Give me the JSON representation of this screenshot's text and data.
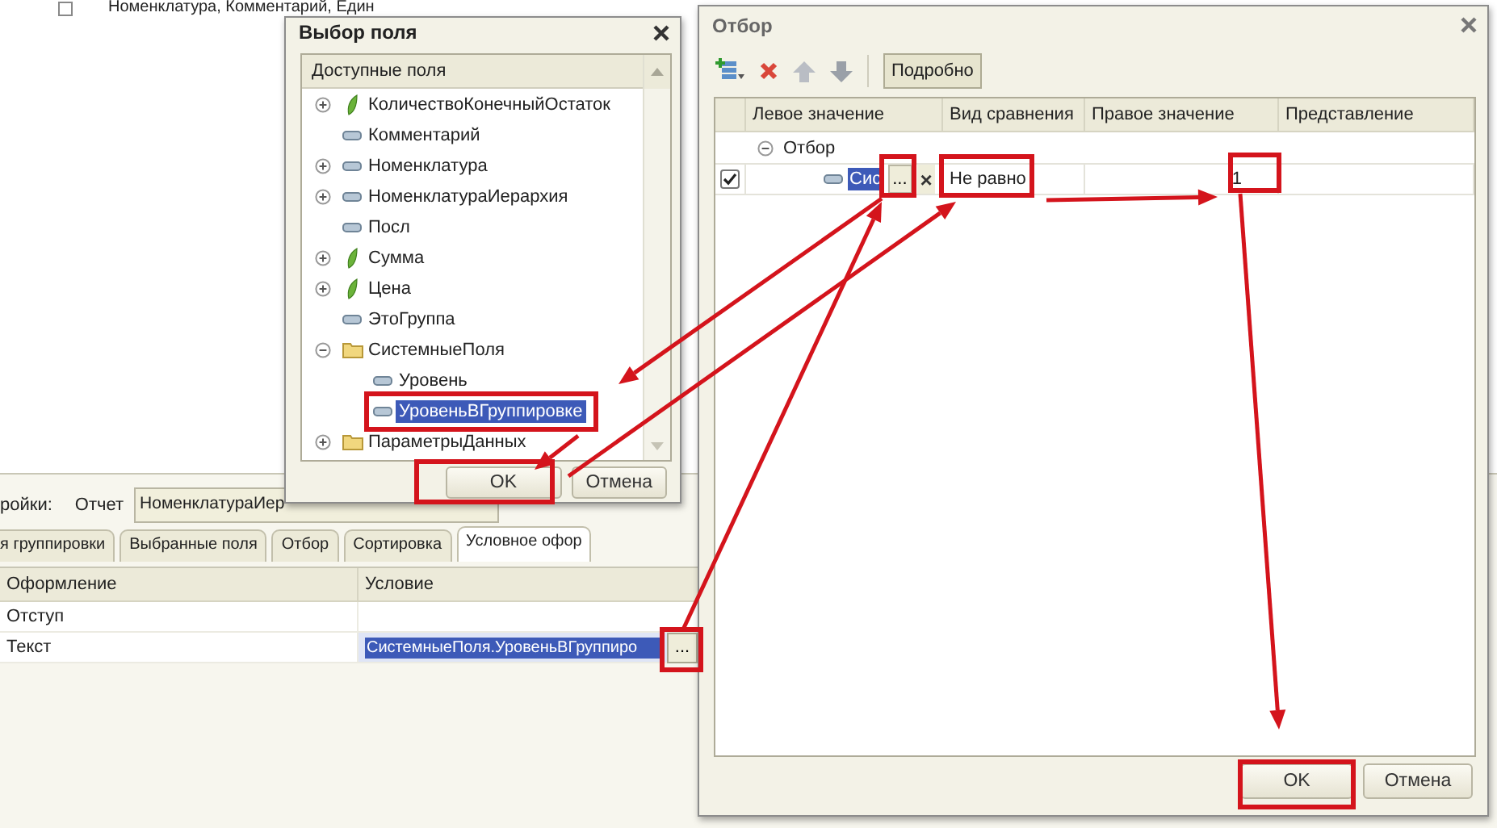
{
  "background_window": {
    "top_text": "Номенклатура, Комментарий, Един",
    "settings_label": "ройки:",
    "report_label": "Отчет",
    "report_field": "НоменклатураИер",
    "tabs": [
      {
        "label": "я группировки",
        "selected": false
      },
      {
        "label": "Выбранные поля",
        "selected": false
      },
      {
        "label": "Отбор",
        "selected": false
      },
      {
        "label": "Сортировка",
        "selected": false
      },
      {
        "label": "Условное офор",
        "selected": true
      }
    ],
    "table": {
      "columns": [
        "Оформление",
        "Условие"
      ],
      "rows": [
        {
          "appearance": "Отступ",
          "selected": false
        },
        {
          "appearance": "Текст",
          "condition": "СистемныеПоля.УровеньВГруппиро",
          "choose_label": "...",
          "selected": true
        }
      ]
    }
  },
  "field_picker": {
    "title": "Выбор поля",
    "tree_header": "Доступные поля",
    "tree": [
      {
        "label": "КоличествоКонечныйОстаток",
        "kind": "resource",
        "has_children": true,
        "expanded": false,
        "selected": false
      },
      {
        "label": "Комментарий",
        "kind": "field",
        "has_children": false,
        "expanded": false,
        "selected": false
      },
      {
        "label": "Номенклатура",
        "kind": "field",
        "has_children": true,
        "expanded": false,
        "selected": false
      },
      {
        "label": "НоменклатураИерархия",
        "kind": "field",
        "has_children": true,
        "expanded": false,
        "selected": false
      },
      {
        "label": "Посл",
        "kind": "field",
        "has_children": false,
        "expanded": false,
        "selected": false
      },
      {
        "label": "Сумма",
        "kind": "resource",
        "has_children": true,
        "expanded": false,
        "selected": false
      },
      {
        "label": "Цена",
        "kind": "resource",
        "has_children": true,
        "expanded": false,
        "selected": false
      },
      {
        "label": "ЭтоГруппа",
        "kind": "field",
        "has_children": false,
        "expanded": false,
        "selected": false
      },
      {
        "label": "СистемныеПоля",
        "kind": "folder",
        "has_children": true,
        "expanded": true,
        "selected": false,
        "children": [
          {
            "label": "Уровень",
            "kind": "field",
            "has_children": false,
            "expanded": false,
            "selected": false
          },
          {
            "label": "УровеньВГруппировке",
            "kind": "field",
            "has_children": false,
            "expanded": false,
            "selected": true
          }
        ]
      },
      {
        "label": "ПараметрыДанных",
        "kind": "folder",
        "has_children": true,
        "expanded": false,
        "selected": false
      }
    ],
    "buttons": [
      {
        "label": "OK",
        "default": true
      },
      {
        "label": "Отмена",
        "default": false
      }
    ]
  },
  "filter_dialog": {
    "title": "Отбор",
    "details_label": "Подробно",
    "details_pressed": true,
    "columns": [
      "Левое значение",
      "Вид сравнения",
      "Правое значение",
      "Представление"
    ],
    "groups": [
      {
        "label": "Отбор",
        "expanded": true,
        "children": [
          {
            "checked": true,
            "left_value": "Сис",
            "editing": true,
            "choose_label": "...",
            "clear_label": "×",
            "comparison": "Не равно",
            "right_value": "1"
          }
        ]
      }
    ],
    "buttons": [
      {
        "label": "OK",
        "default": true
      },
      {
        "label": "Отмена",
        "default": false
      }
    ]
  }
}
